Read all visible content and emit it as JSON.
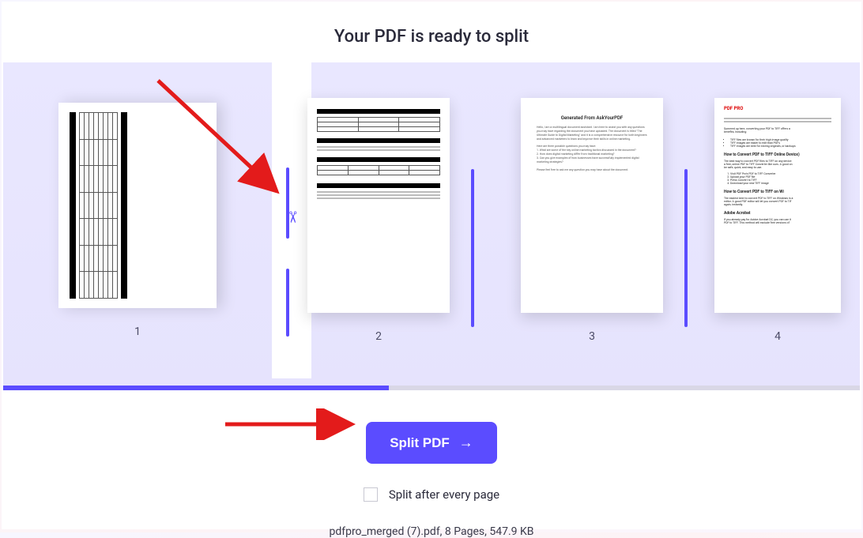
{
  "header": {
    "title": "Your PDF is ready to split"
  },
  "pages": {
    "labels": [
      "1",
      "2",
      "3",
      "4"
    ]
  },
  "page3": {
    "heading": "Generated From AskYourPDF"
  },
  "page4": {
    "brand": "PDF PRO",
    "h1": "How to Convert PDF to TIFF Online Device)",
    "h2": "How to Convert PDF to TIFF on Wi",
    "h3": "Adobe Acrobat"
  },
  "actions": {
    "split_label": "Split PDF",
    "split_every_label": "Split after every page"
  },
  "file": {
    "summary": "pdfpro_merged (7).pdf, 8 Pages, 547.9 KB"
  },
  "icons": {
    "scissors": "scissors-icon",
    "arrow_right": "arrow-right-icon"
  }
}
